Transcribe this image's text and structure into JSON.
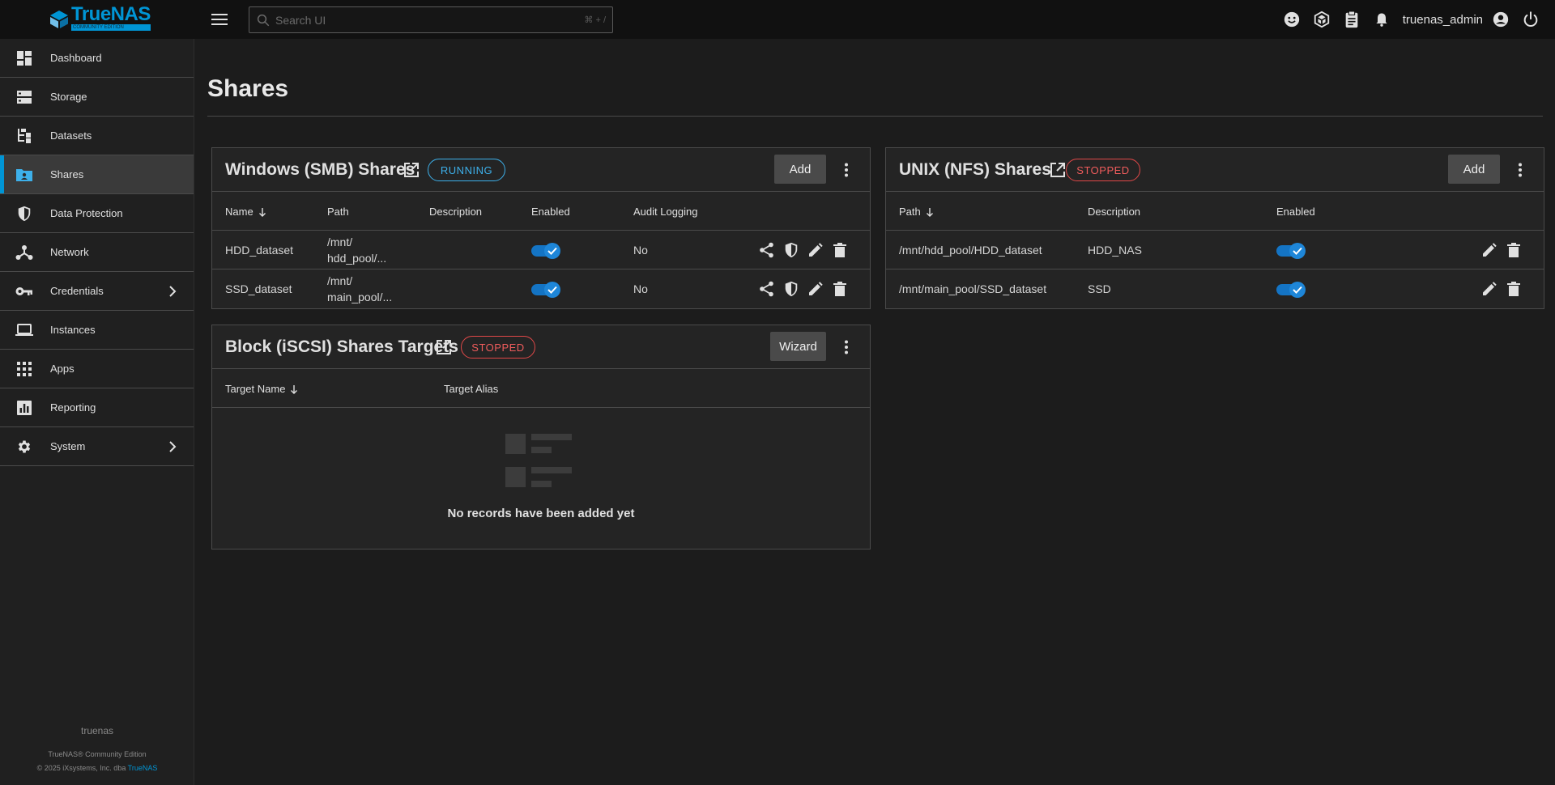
{
  "app": {
    "logo_name": "TrueNAS",
    "logo_edition": "Community Edition"
  },
  "topbar": {
    "search_placeholder": "Search UI",
    "search_shortcut": "⌘ + /",
    "username": "truenas_admin",
    "icons": [
      "feedback-icon",
      "truecommand-icon",
      "jobs-icon",
      "alerts-bell-icon",
      "account-circle-icon",
      "power-icon"
    ]
  },
  "sidebar": {
    "items": [
      {
        "label": "Dashboard",
        "icon": "dashboard-icon"
      },
      {
        "label": "Storage",
        "icon": "storage-icon"
      },
      {
        "label": "Datasets",
        "icon": "datasets-icon"
      },
      {
        "label": "Shares",
        "icon": "shares-folder-icon",
        "active": true
      },
      {
        "label": "Data Protection",
        "icon": "shield-icon"
      },
      {
        "label": "Network",
        "icon": "network-icon"
      },
      {
        "label": "Credentials",
        "icon": "key-icon",
        "expandable": true
      },
      {
        "label": "Instances",
        "icon": "laptop-icon"
      },
      {
        "label": "Apps",
        "icon": "apps-grid-icon"
      },
      {
        "label": "Reporting",
        "icon": "reporting-chart-icon"
      },
      {
        "label": "System",
        "icon": "gear-icon",
        "expandable": true
      }
    ],
    "hostname": "truenas",
    "copyright_line1": "TrueNAS® Community Edition",
    "copyright_line2": "© 2025 iXsystems, Inc. dba",
    "copyright_link": "TrueNAS"
  },
  "page": {
    "title": "Shares"
  },
  "smb": {
    "title": "Windows (SMB) Shares",
    "status": "RUNNING",
    "add_label": "Add",
    "columns": [
      "Name",
      "Path",
      "Description",
      "Enabled",
      "Audit Logging"
    ],
    "rows": [
      {
        "name": "HDD_dataset",
        "path_line1": "/mnt/",
        "path_line2": "hdd_pool/...",
        "description": "",
        "enabled": true,
        "audit": "No"
      },
      {
        "name": "SSD_dataset",
        "path_line1": "/mnt/",
        "path_line2": "main_pool/...",
        "description": "",
        "enabled": true,
        "audit": "No"
      }
    ]
  },
  "nfs": {
    "title": "UNIX (NFS) Shares",
    "status": "STOPPED",
    "add_label": "Add",
    "columns": [
      "Path",
      "Description",
      "Enabled"
    ],
    "rows": [
      {
        "path": "/mnt/hdd_pool/HDD_dataset",
        "description": "HDD_NAS",
        "enabled": true
      },
      {
        "path": "/mnt/main_pool/SSD_dataset",
        "description": "SSD",
        "enabled": true
      }
    ]
  },
  "iscsi": {
    "title": "Block (iSCSI) Shares Targets",
    "status": "STOPPED",
    "wizard_label": "Wizard",
    "columns": [
      "Target Name",
      "Target Alias"
    ],
    "empty_text": "No records have been added yet"
  },
  "colors": {
    "accent": "#0095d5",
    "running": "#3db0ea",
    "stopped": "#ef5c5c",
    "toggle_on": "#1474c4"
  }
}
